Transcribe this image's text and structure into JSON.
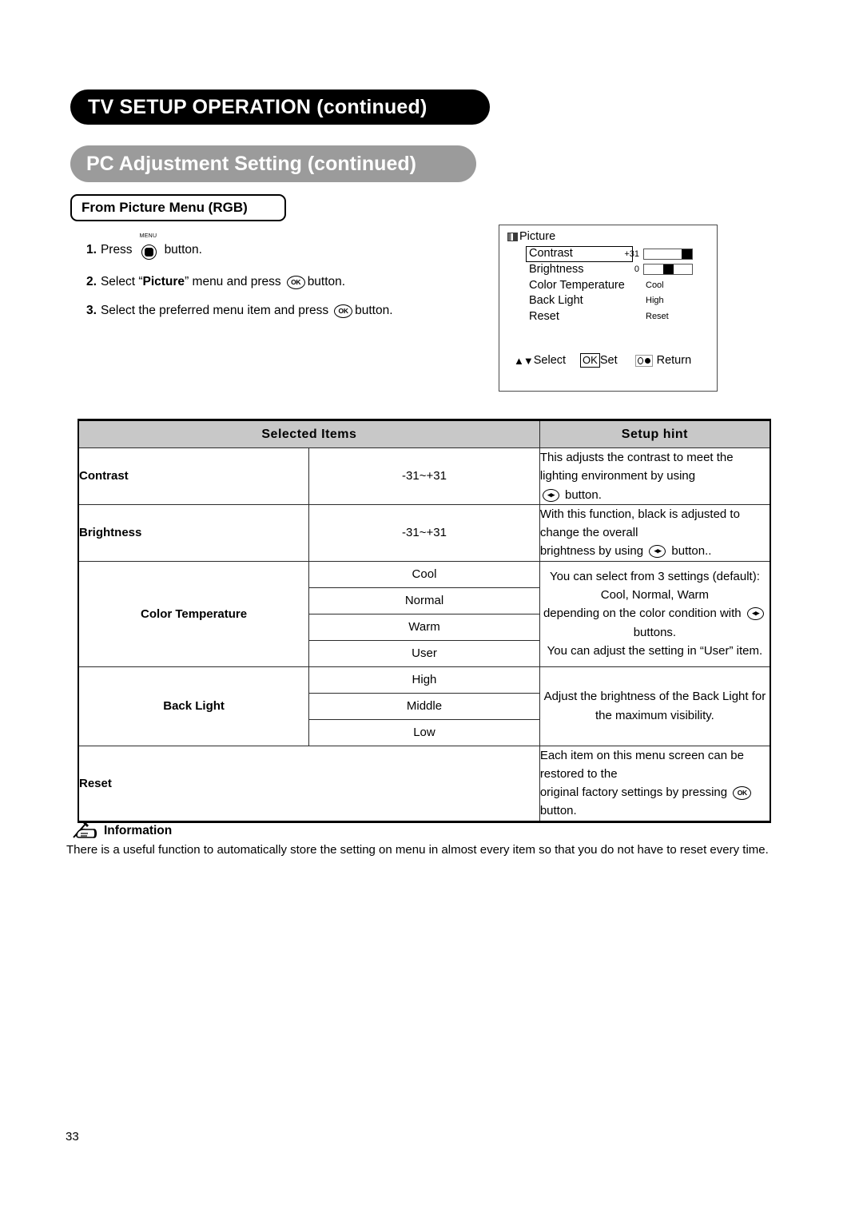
{
  "header": {
    "chapter_banner": "TV SETUP OPERATION (continued)",
    "section_banner": "PC Adjustment Setting (continued)",
    "subsection_banner": "From Picture Menu (RGB)"
  },
  "steps": [
    {
      "num": "1.",
      "before": "Press",
      "icon": "menu-button-icon",
      "icon_label": "MENU",
      "after": "button."
    },
    {
      "num": "2.",
      "before": "Select “",
      "emphasis": "Picture",
      "middle": "” menu and press",
      "icon": "ok-button-icon",
      "after": "button."
    },
    {
      "num": "3.",
      "before": "Select the preferred menu item and press",
      "icon": "ok-button-icon",
      "after": "button."
    }
  ],
  "osd": {
    "title": "Picture",
    "rows": [
      {
        "label": "Contrast",
        "selected": true,
        "number": "+31",
        "bar": true,
        "knob_position": "right"
      },
      {
        "label": "Brightness",
        "selected": false,
        "number": "0",
        "bar": true,
        "knob_position": "center"
      },
      {
        "label": "Color Temperature",
        "value": "Cool"
      },
      {
        "label": "Back Light",
        "value": "High"
      },
      {
        "label": "Reset",
        "value": "Reset"
      }
    ],
    "footer": {
      "select": "Select",
      "ok": "OK",
      "set": "Set",
      "return": "Return"
    }
  },
  "table": {
    "headers": [
      "Selected Items",
      "Setup hint"
    ],
    "rows": [
      {
        "item": "Contrast",
        "values": [
          "-31~+31"
        ],
        "hint_lines": [
          {
            "text": "This adjusts the contrast to meet the lighting environment by using"
          },
          {
            "icon": "left-right-button-icon",
            "text_after": "button."
          }
        ]
      },
      {
        "item": "Brightness",
        "values": [
          "-31~+31"
        ],
        "hint_lines": [
          {
            "text": "With this function, black is adjusted to change the overall"
          },
          {
            "text_before": "brightness by using",
            "icon": "left-right-button-icon",
            "text_after": "button.."
          }
        ]
      },
      {
        "item": "Color Temperature",
        "values": [
          "Cool",
          "Normal",
          "Warm",
          "User"
        ],
        "hint_lines": [
          {
            "text": "You can select from 3 settings (default): Cool, Normal, Warm"
          },
          {
            "text_before": "depending on the color condition with",
            "icon": "left-right-button-icon",
            "text_after": "buttons."
          },
          {
            "text": "You can adjust the setting in “User” item."
          }
        ]
      },
      {
        "item": "Back Light",
        "values": [
          "High",
          "Middle",
          "Low"
        ],
        "hint_lines": [
          {
            "text": "Adjust the brightness of the Back Light for the maximum visibility."
          }
        ]
      },
      {
        "item": "Reset",
        "values": [],
        "hint_lines": [
          {
            "text": "Each item on this menu screen can be restored to the"
          },
          {
            "text_before": "original factory settings by pressing",
            "icon": "ok-button-icon",
            "text_after": "button."
          }
        ]
      }
    ]
  },
  "information": {
    "heading": "Information",
    "icon": "hand-writing-icon",
    "body": "There is a useful function to automatically store the setting on menu in almost every item so that you do not have to reset every time."
  },
  "footer": {
    "page_number": "33"
  },
  "colors": {
    "banner_black": "#000000",
    "banner_gray": "#9b9b9b",
    "table_header_gray": "#c8c8c8"
  }
}
